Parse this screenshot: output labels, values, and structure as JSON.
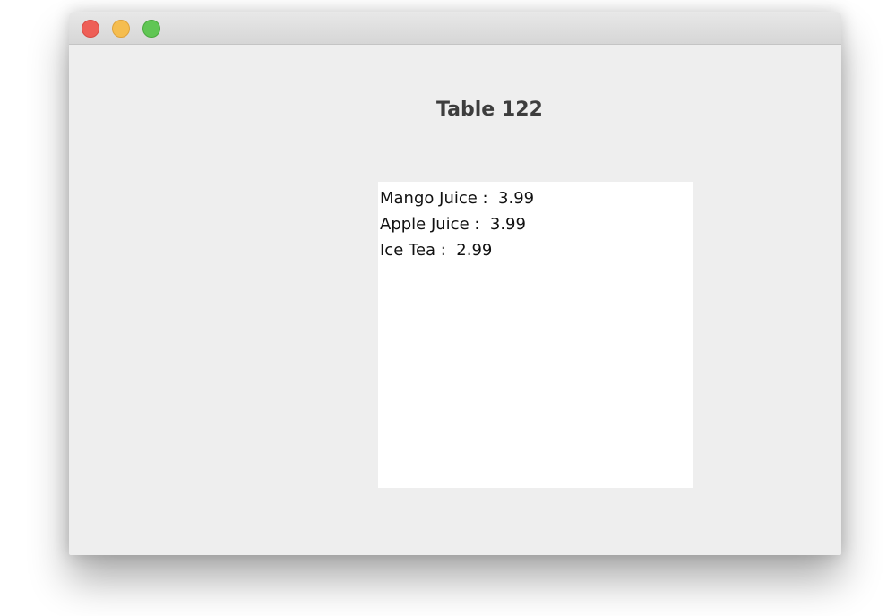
{
  "window": {
    "controls": {
      "close": "close-button",
      "minimize": "minimize-button",
      "zoom": "zoom-button"
    }
  },
  "main": {
    "title": "Table 122",
    "order_items": [
      {
        "text": "Mango Juice :  3.99"
      },
      {
        "text": "Apple Juice :  3.99"
      },
      {
        "text": "Ice Tea :  2.99"
      }
    ]
  },
  "colors": {
    "window_background": "#eeeeee",
    "list_background": "#ffffff",
    "close": "#ee5f57",
    "minimize": "#f5bd4f",
    "zoom": "#60c654"
  }
}
